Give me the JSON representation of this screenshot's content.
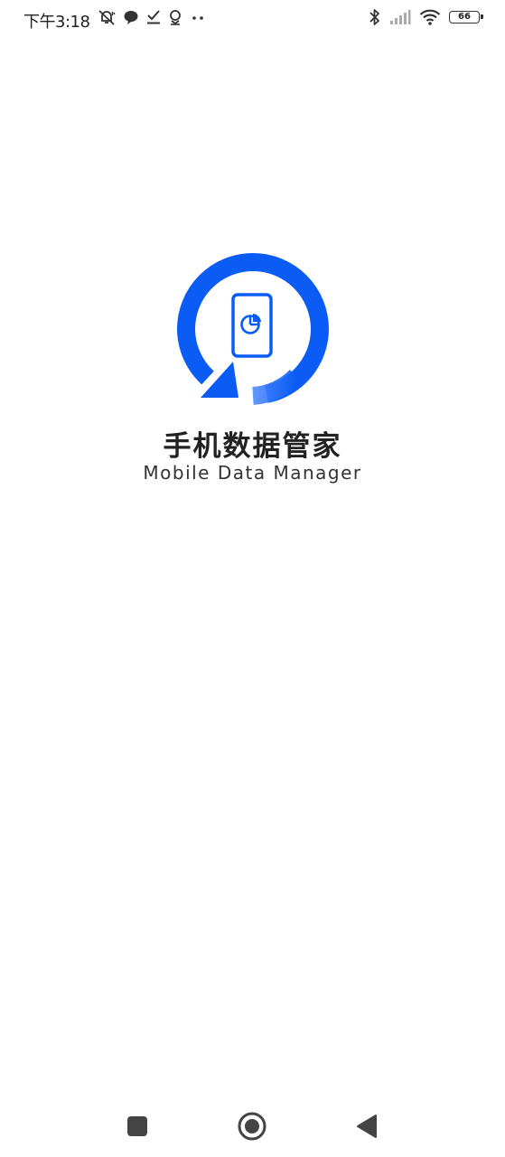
{
  "status_bar": {
    "time": "下午3:18",
    "battery_level": "66",
    "left_icons": [
      "mute-bell-icon",
      "chat-bubble-icon",
      "check-download-icon",
      "location-pin-icon",
      "more-dots-icon"
    ],
    "right_icons": [
      "bluetooth-icon",
      "cellular-signal-icon",
      "wifi-icon",
      "battery-icon"
    ]
  },
  "splash": {
    "title": "手机数据管家",
    "subtitle": "Mobile Data Manager",
    "logo_icon": "phone-sync-logo-icon",
    "brand_color": "#0a5cf5"
  },
  "nav_bar": {
    "buttons": [
      "recents-square-icon",
      "home-circle-icon",
      "back-triangle-icon"
    ]
  }
}
